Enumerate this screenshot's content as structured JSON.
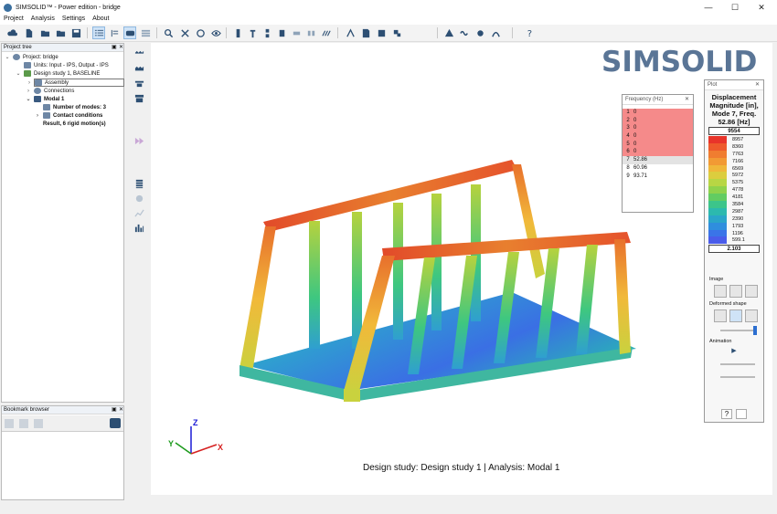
{
  "window": {
    "title": "SIMSOLID™ - Power edition - bridge",
    "minimize": "—",
    "maximize": "☐",
    "close": "✕"
  },
  "menu": [
    "Project",
    "Analysis",
    "Settings",
    "About"
  ],
  "project_tree": {
    "header": "Project tree",
    "items": [
      {
        "label": "Project: bridge",
        "bold": false
      },
      {
        "label": "Units: Input - IPS, Output - IPS",
        "bold": false
      },
      {
        "label": "Design study 1, BASELINE",
        "bold": false
      },
      {
        "label": "Assembly",
        "bold": false
      },
      {
        "label": "Connections",
        "bold": false
      },
      {
        "label": "Modal 1",
        "bold": true
      },
      {
        "label": "Number of modes: 3",
        "bold": true
      },
      {
        "label": "Contact conditions",
        "bold": true
      },
      {
        "label": "Result, 6 rigid motion(s)",
        "bold": true
      }
    ]
  },
  "bookmark_browser": {
    "header": "Bookmark browser"
  },
  "viewport": {
    "logo": "SIMSOLID",
    "caption": "Design study: Design study 1 | Analysis: Modal 1",
    "axes": {
      "x": "X",
      "y": "Y",
      "z": "Z"
    }
  },
  "frequency_panel": {
    "header": "Frequency (Hz)",
    "rows": [
      {
        "n": "1",
        "v": "0"
      },
      {
        "n": "2",
        "v": "0"
      },
      {
        "n": "3",
        "v": "0"
      },
      {
        "n": "4",
        "v": "0"
      },
      {
        "n": "5",
        "v": "0"
      },
      {
        "n": "6",
        "v": "0"
      },
      {
        "n": "7",
        "v": "52.86"
      },
      {
        "n": "8",
        "v": "60.96"
      },
      {
        "n": "9",
        "v": "93.71"
      }
    ]
  },
  "plot_panel": {
    "header": "Plot",
    "title": "Displacement Magnitude [in], Mode 7, Freq. 52.86 [Hz]",
    "max": "9554",
    "min": "2.103",
    "legend": [
      "8957",
      "8360",
      "7763",
      "7166",
      "6569",
      "5972",
      "5375",
      "4778",
      "4181",
      "3584",
      "2987",
      "2390",
      "1793",
      "1196",
      "599.1"
    ],
    "legend_colors": [
      "#e8342a",
      "#ee5a2c",
      "#f07d30",
      "#f29a34",
      "#f0b73a",
      "#dccd3e",
      "#b8d644",
      "#8fd24c",
      "#62cc62",
      "#3cc58a",
      "#2cb9ae",
      "#2aa5c9",
      "#2f8ede",
      "#3a74e8",
      "#4a5cea"
    ],
    "image_label": "Image",
    "deformed_label": "Deformed shape",
    "animation_label": "Animation",
    "help": "?"
  },
  "colors": {
    "accent": "#5a7596",
    "highlight": "#f58a8a"
  }
}
